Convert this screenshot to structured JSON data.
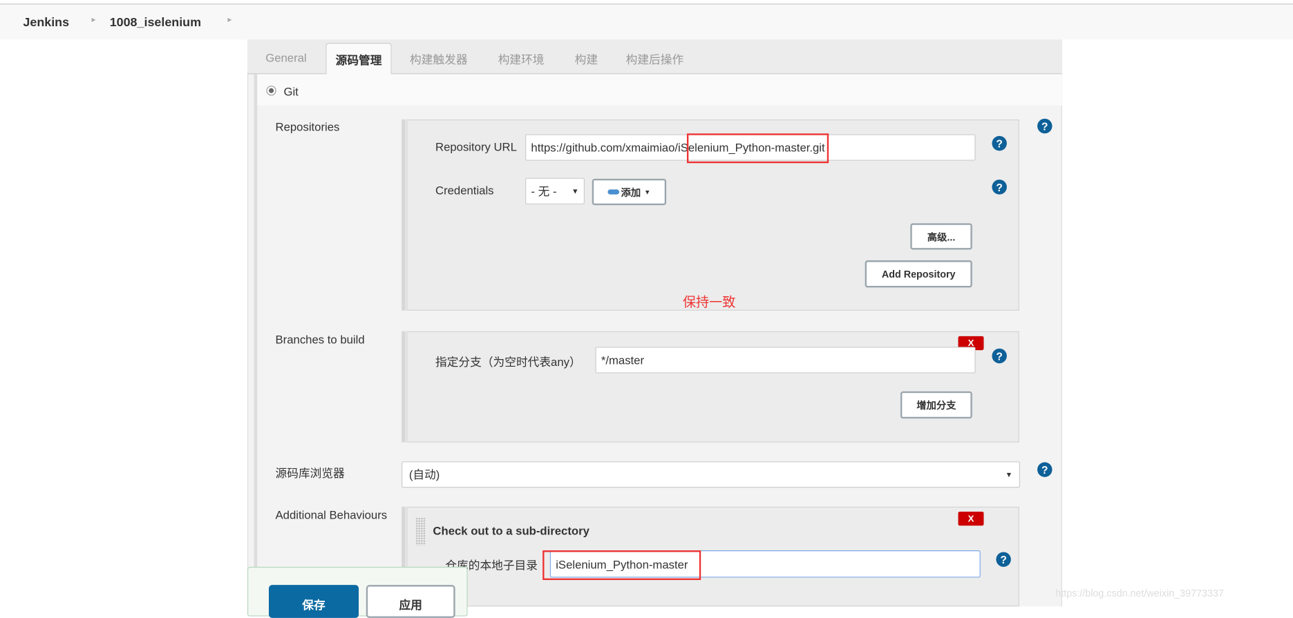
{
  "breadcrumb": {
    "items": [
      "Jenkins",
      "1008_iselenium"
    ],
    "separator": "▸"
  },
  "tabs": [
    {
      "label": "General"
    },
    {
      "label": "源码管理",
      "active": true
    },
    {
      "label": "构建触发器"
    },
    {
      "label": "构建环境"
    },
    {
      "label": "构建"
    },
    {
      "label": "构建后操作"
    }
  ],
  "scm": {
    "git_label": "Git",
    "repositories_label": "Repositories",
    "repo_url_label": "Repository URL",
    "repo_url_value": "https://github.com/xmaimiao/iSelenium_Python-master.git",
    "credentials_label": "Credentials",
    "credentials_value": "- 无 -",
    "add_label": "添加",
    "advanced_label": "高级...",
    "add_repository_label": "Add Repository",
    "annotation": "保持一致",
    "branches_label": "Branches to build",
    "branch_spec_label": "指定分支（为空时代表any）",
    "branch_spec_value": "*/master",
    "add_branch_label": "增加分支",
    "delete_label": "X",
    "browser_label": "源码库浏览器",
    "browser_value": "(自动)",
    "behaviours_label": "Additional Behaviours",
    "checkout_title": "Check out to a sub-directory",
    "subdir_label": "仓库的本地子目录",
    "subdir_value": "iSelenium_Python-master",
    "help": "?"
  },
  "footer": {
    "save_label": "保存",
    "apply_label": "应用"
  },
  "watermark": "https://blog.csdn.net/weixin_39773337",
  "colors": {
    "primary": "#0b6aa2",
    "delete": "#cc0000",
    "help": "#0e6098",
    "highlight": "#ee3333"
  }
}
